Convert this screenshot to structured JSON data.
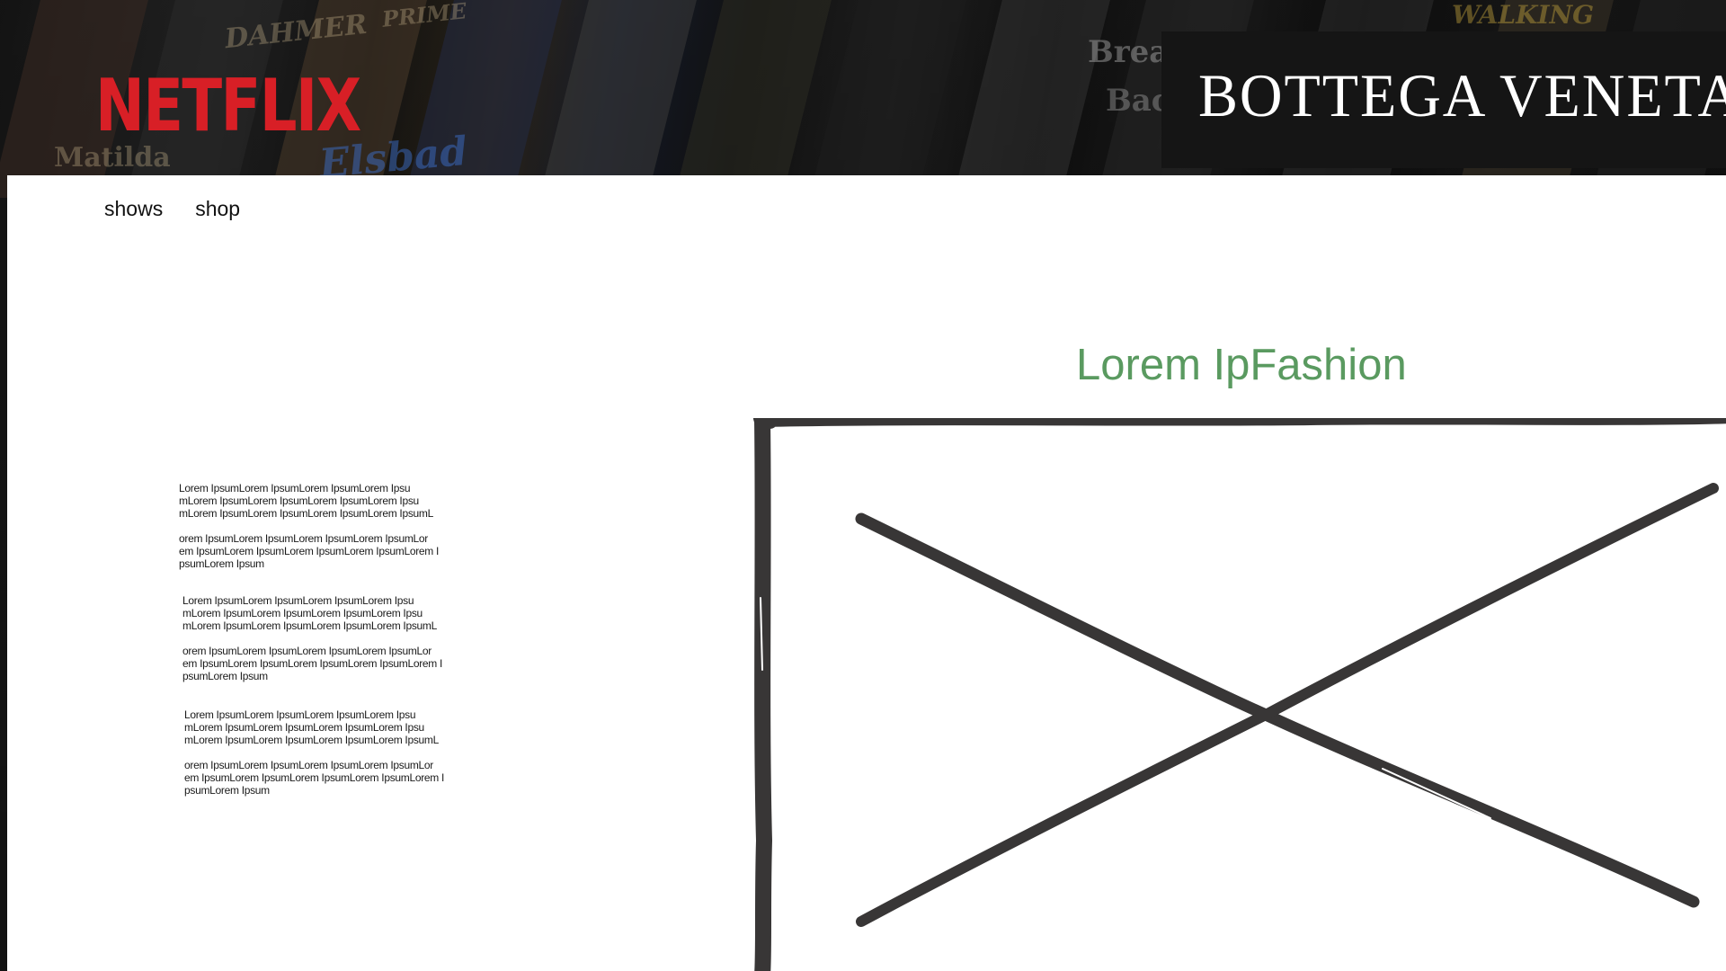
{
  "brand": {
    "netflix": "NETFLIX",
    "bottega": "BOTTEGA VENETA"
  },
  "backdrop": {
    "poster_titles": [
      "DAHMER",
      "PRIME",
      "Brea",
      "Bac",
      "Matilda",
      "WALKING",
      "Elsbad"
    ]
  },
  "nav": {
    "items": [
      {
        "label": "shows"
      },
      {
        "label": "shop"
      }
    ]
  },
  "hero": {
    "title": "Lorem IpFashion"
  },
  "text_blocks": [
    {
      "para1": "Lorem IpsumLorem IpsumLorem IpsumLorem Ipsu\nmLorem IpsumLorem IpsumLorem IpsumLorem Ipsu\nmLorem IpsumLorem IpsumLorem IpsumLorem IpsumL",
      "para2": "orem IpsumLorem IpsumLorem IpsumLorem IpsumLor\nem IpsumLorem IpsumLorem IpsumLorem IpsumLorem I\npsumLorem Ipsum"
    },
    {
      "para1": "Lorem IpsumLorem IpsumLorem IpsumLorem Ipsu\nmLorem IpsumLorem IpsumLorem IpsumLorem Ipsu\nmLorem IpsumLorem IpsumLorem IpsumLorem IpsumL",
      "para2": "orem IpsumLorem IpsumLorem IpsumLorem IpsumLor\nem IpsumLorem IpsumLorem IpsumLorem IpsumLorem I\npsumLorem Ipsum"
    },
    {
      "para1": "Lorem IpsumLorem IpsumLorem IpsumLorem Ipsu\nmLorem IpsumLorem IpsumLorem IpsumLorem Ipsu\nmLorem IpsumLorem IpsumLorem IpsumLorem IpsumL",
      "para2": "orem IpsumLorem IpsumLorem IpsumLorem IpsumLor\nem IpsumLorem IpsumLorem IpsumLorem IpsumLorem I\npsumLorem Ipsum"
    }
  ],
  "colors": {
    "netflix_red": "#d81f26",
    "title_green": "#5a9a60",
    "sketch_stroke": "#383636"
  },
  "icons": {
    "image_placeholder": "image-placeholder-icon"
  }
}
